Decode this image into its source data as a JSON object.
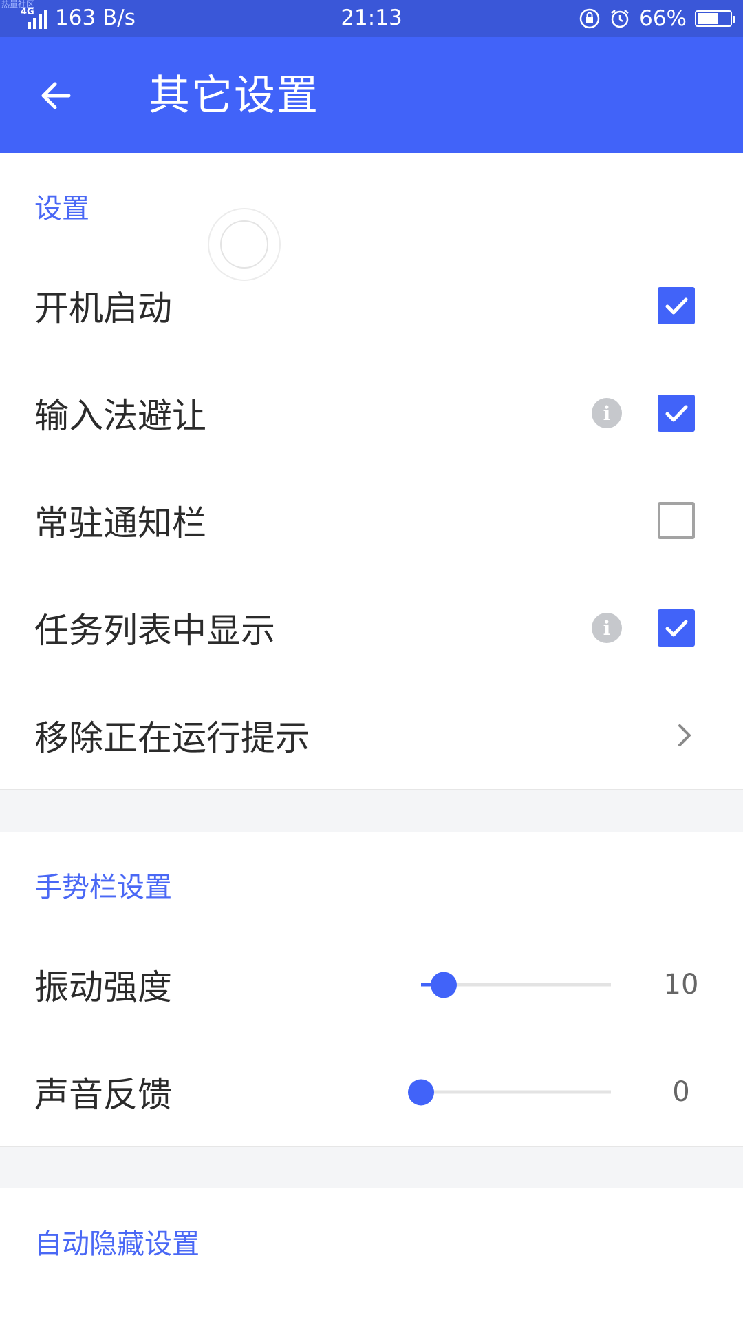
{
  "status_bar": {
    "net_tag": "热量社区",
    "network_type": "4G",
    "speed": "163 B/s",
    "time": "21:13",
    "battery_percent": "66%",
    "battery_level": 0.66,
    "icons": [
      "signal-icon",
      "rotation-lock-icon",
      "alarm-icon",
      "battery-icon"
    ]
  },
  "app_bar": {
    "title": "其它设置",
    "back_icon": "arrow-left-icon",
    "color": "#4163f9"
  },
  "sections": {
    "general": {
      "header": "设置",
      "items": [
        {
          "label": "开机启动",
          "control": "checkbox",
          "checked": true
        },
        {
          "label": "输入法避让",
          "control": "checkbox",
          "checked": true,
          "info": true
        },
        {
          "label": "常驻通知栏",
          "control": "checkbox",
          "checked": false
        },
        {
          "label": "任务列表中显示",
          "control": "checkbox",
          "checked": true,
          "info": true
        },
        {
          "label": "移除正在运行提示",
          "control": "chevron"
        }
      ]
    },
    "gesture": {
      "header": "手势栏设置",
      "items": [
        {
          "label": "振动强度",
          "value": "10",
          "fraction": 0.12
        },
        {
          "label": "声音反馈",
          "value": "0",
          "fraction": 0.0
        }
      ]
    },
    "autohide": {
      "header": "自动隐藏设置"
    }
  },
  "colors": {
    "accent": "#4163f9",
    "section_header": "#4a68f5",
    "status_bar": "#3a57d8"
  }
}
